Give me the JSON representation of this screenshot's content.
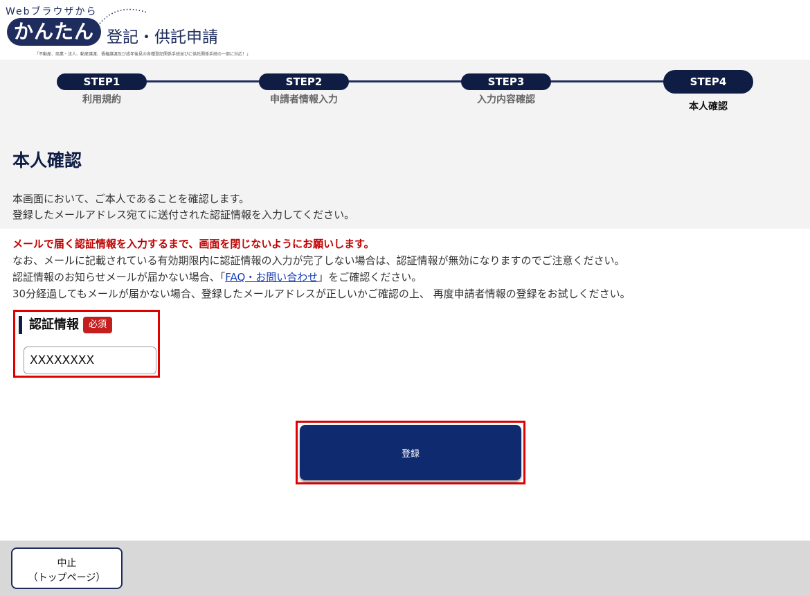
{
  "header": {
    "logo_top": "Webブラウザから",
    "logo_kantan": "かんたん",
    "logo_title": "登記・供託申請",
    "logo_sub": "「不動産、商業・法人、動産譲渡、債権譲渡及び成年後見の各種登記関係手続並びに供託関係手続の一部に対応！」"
  },
  "steps": [
    {
      "pill": "STEP1",
      "label": "利用規約"
    },
    {
      "pill": "STEP2",
      "label": "申請者情報入力"
    },
    {
      "pill": "STEP3",
      "label": "入力内容確認"
    },
    {
      "pill": "STEP4",
      "label": "本人確認"
    }
  ],
  "page": {
    "title": "本人確認",
    "intro_line1": "本画面において、ご本人であることを確認します。",
    "intro_line2": "登録したメールアドレス宛てに送付された認証情報を入力してください。"
  },
  "notice": {
    "warning": "メールで届く認証情報を入力するまで、画面を閉じないようにお願いします。",
    "line2": "なお、メールに記載されている有効期限内に認証情報の入力が完了しない場合は、認証情報が無効になりますのでご注意ください。",
    "line3_prefix": "認証情報のお知らせメールが届かない場合、「",
    "line3_link": "FAQ・お問い合わせ",
    "line3_suffix": "」をご確認ください。",
    "line4": "30分経過してもメールが届かない場合、登録したメールアドレスが正しいかご確認の上、 再度申請者情報の登録をお試しください。"
  },
  "form": {
    "label": "認証情報",
    "required_badge": "必須",
    "value": "XXXXXXXX"
  },
  "actions": {
    "register_label": "登録",
    "cancel_line1": "中止",
    "cancel_line2": "（トップページ）"
  }
}
